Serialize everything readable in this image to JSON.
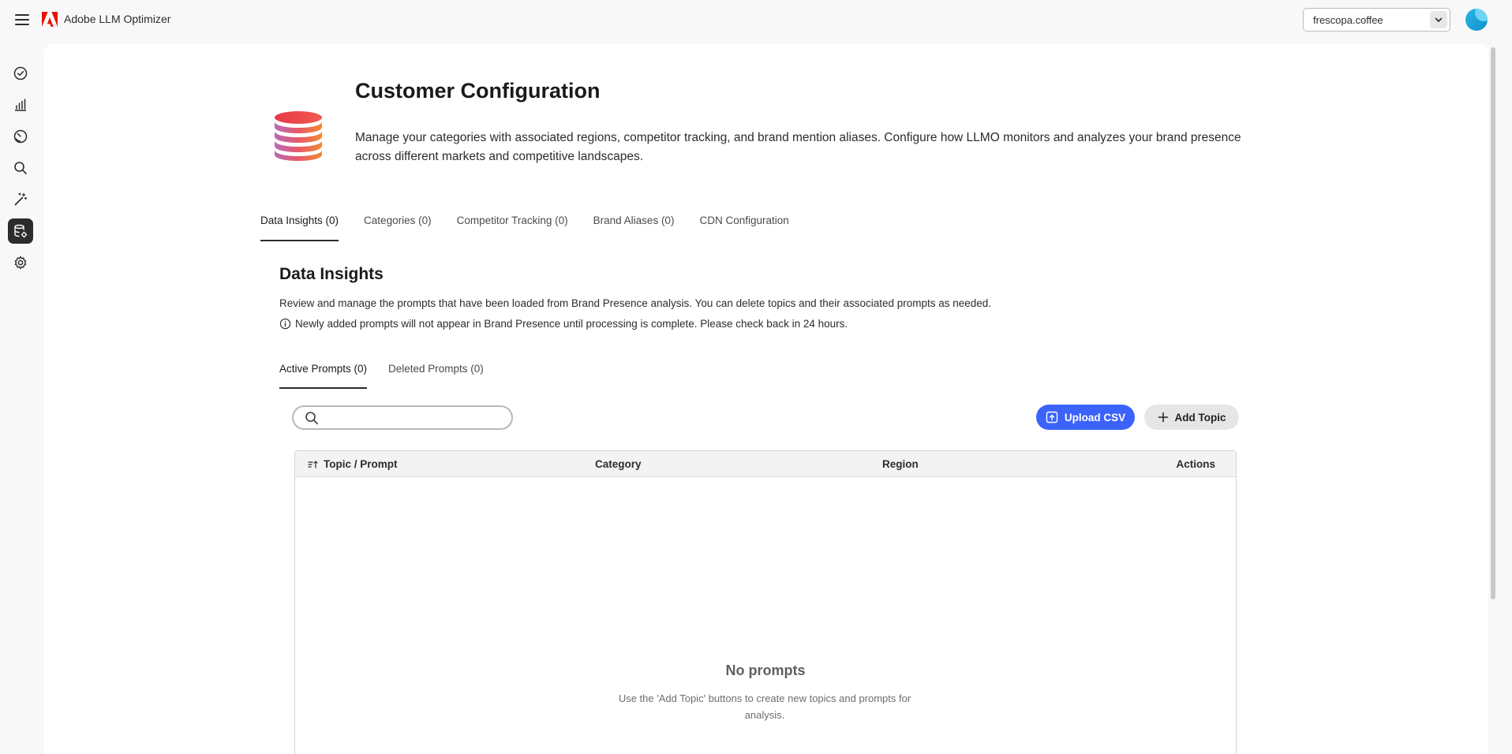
{
  "app": {
    "title": "Adobe LLM Optimizer"
  },
  "org_select": {
    "value": "frescopa.coffee"
  },
  "rail": {
    "items": [
      {
        "icon": "check-circle-icon"
      },
      {
        "icon": "bar-chart-icon"
      },
      {
        "icon": "gauge-icon"
      },
      {
        "icon": "search-icon"
      },
      {
        "icon": "magic-wand-icon"
      },
      {
        "icon": "database-settings-icon",
        "active": true
      },
      {
        "icon": "gear-icon"
      }
    ]
  },
  "page": {
    "title": "Customer Configuration",
    "description": "Manage your categories with associated regions, competitor tracking, and brand mention aliases. Configure how LLMO monitors and analyzes your brand presence across different markets and competitive landscapes."
  },
  "tabs": [
    {
      "label": "Data Insights (0)",
      "active": true
    },
    {
      "label": "Categories (0)"
    },
    {
      "label": "Competitor Tracking (0)"
    },
    {
      "label": "Brand Aliases (0)"
    },
    {
      "label": "CDN Configuration"
    }
  ],
  "section": {
    "title": "Data Insights",
    "description": "Review and manage the prompts that have been loaded from Brand Presence analysis. You can delete topics and their associated prompts as needed.",
    "notice": "Newly added prompts will not appear in Brand Presence until processing is complete. Please check back in 24 hours."
  },
  "subtabs": [
    {
      "label": "Active Prompts (0)",
      "active": true
    },
    {
      "label": "Deleted Prompts (0)"
    }
  ],
  "search": {
    "placeholder": "",
    "value": ""
  },
  "buttons": {
    "upload": "Upload CSV",
    "add_topic": "Add Topic"
  },
  "table": {
    "columns": [
      "Topic / Prompt",
      "Category",
      "Region",
      "Actions"
    ],
    "empty_title": "No prompts",
    "empty_desc": "Use the 'Add Topic' buttons to create new topics and prompts for analysis."
  },
  "colors": {
    "accent": "#3b63fb",
    "adobe_red": "#eb1000",
    "active_rail": "#2c2c2c"
  }
}
